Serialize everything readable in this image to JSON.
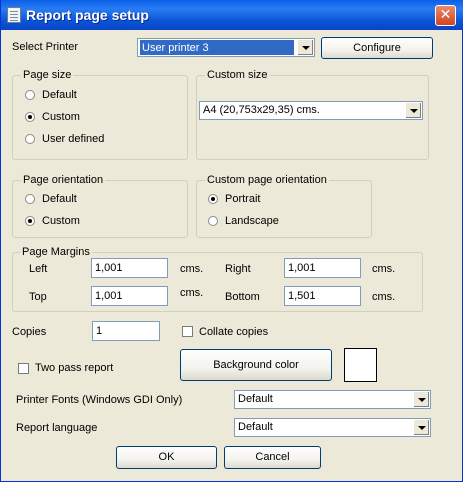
{
  "window": {
    "title": "Report page setup",
    "close_glyph": "✕"
  },
  "printer": {
    "label": "Select Printer",
    "selected": "User printer 3",
    "configure_label": "Configure"
  },
  "page_size": {
    "legend": "Page size",
    "options": [
      "Default",
      "Custom",
      "User defined"
    ],
    "selected": "Custom"
  },
  "custom_size": {
    "legend": "Custom size",
    "selected": "A4 (20,753x29,35) cms."
  },
  "page_orientation": {
    "legend": "Page orientation",
    "options": [
      "Default",
      "Custom"
    ],
    "selected": "Custom"
  },
  "custom_orientation": {
    "legend": "Custom page orientation",
    "options": [
      "Portrait",
      "Landscape"
    ],
    "selected": "Portrait"
  },
  "margins": {
    "legend": "Page Margins",
    "left_label": "Left",
    "left_value": "1,001",
    "right_label": "Right",
    "right_value": "1,001",
    "top_label": "Top",
    "top_value": "1,001",
    "bottom_label": "Bottom",
    "bottom_value": "1,501",
    "unit": "cms."
  },
  "copies": {
    "label": "Copies",
    "value": "1",
    "collate_label": "Collate copies",
    "collate_checked": false
  },
  "two_pass": {
    "label": "Two pass report",
    "checked": false
  },
  "background": {
    "button_label": "Background color",
    "color": "#ffffff"
  },
  "printer_fonts": {
    "label": "Printer Fonts (Windows GDI Only)",
    "selected": "Default"
  },
  "report_language": {
    "label": "Report language",
    "selected": "Default"
  },
  "buttons": {
    "ok": "OK",
    "cancel": "Cancel"
  }
}
